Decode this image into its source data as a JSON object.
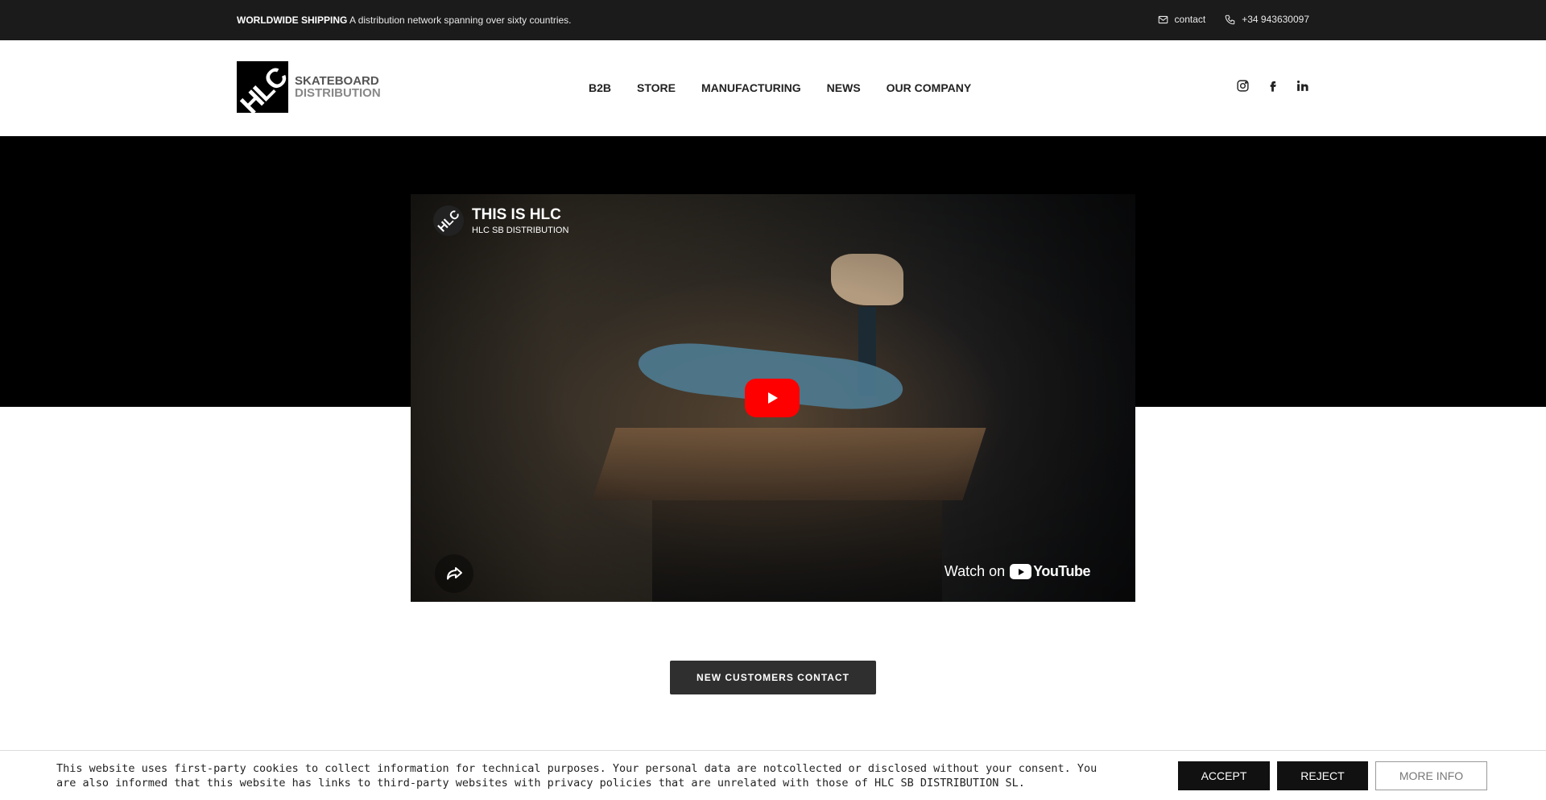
{
  "topbar": {
    "shipping_bold": "WORLDWIDE SHIPPING",
    "shipping_text": "A distribution network spanning over sixty countries.",
    "contact_label": "contact",
    "phone": "+34 943630097",
    "icons": [
      "mail-icon",
      "phone-icon"
    ]
  },
  "header": {
    "logo_mark": "HLC",
    "logo_line1": "SKATEBOARD",
    "logo_line2": "DISTRIBUTION",
    "nav": [
      "B2B",
      "STORE",
      "MANUFACTURING",
      "NEWS",
      "OUR COMPANY"
    ],
    "social_icons": [
      "instagram-icon",
      "facebook-icon",
      "linkedin-icon"
    ]
  },
  "video": {
    "title": "THIS IS HLC",
    "channel": "HLC SB DISTRIBUTION",
    "avatar_text": "HLC",
    "watch_on": "Watch on",
    "platform": "YouTube",
    "play_color": "#ff0000"
  },
  "cta": {
    "label": "NEW CUSTOMERS CONTACT"
  },
  "cookie": {
    "message": "This website uses first-party cookies to collect information for technical purposes. Your personal data are notcollected or disclosed without your consent. You are also informed that this website has links to third-party websites with privacy policies that are unrelated with those of HLC SB DISTRIBUTION SL.",
    "accept": "ACCEPT",
    "reject": "REJECT",
    "more_info": "MORE INFO"
  },
  "colors": {
    "topbar_bg": "#1b1b1b",
    "cta_bg": "#2f2f2f",
    "hero_bg": "#000000"
  }
}
